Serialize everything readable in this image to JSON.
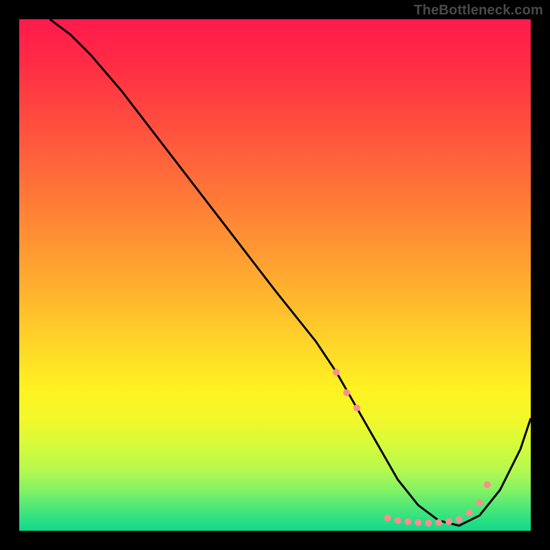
{
  "watermark": "TheBottleneck.com",
  "chart_data": {
    "type": "line",
    "title": "",
    "xlabel": "",
    "ylabel": "",
    "xlim": [
      0,
      100
    ],
    "ylim": [
      0,
      100
    ],
    "background_gradient": {
      "stops": [
        {
          "pos": 0,
          "color": "#ff1a4d"
        },
        {
          "pos": 50,
          "color": "#ffb52e"
        },
        {
          "pos": 75,
          "color": "#fff122"
        },
        {
          "pos": 100,
          "color": "#0fd98c"
        }
      ],
      "direction": "top-to-bottom"
    },
    "series": [
      {
        "name": "bottleneck-curve",
        "color": "#000000",
        "x": [
          6,
          10,
          14,
          20,
          30,
          40,
          50,
          58,
          62,
          66,
          70,
          74,
          78,
          82,
          86,
          90,
          94,
          98,
          100
        ],
        "y": [
          100,
          97,
          93,
          86,
          73,
          60,
          47,
          37,
          31,
          24,
          17,
          10,
          5,
          2,
          1,
          3,
          8,
          16,
          22
        ]
      }
    ],
    "markers": {
      "name": "highlight-points",
      "color": "#ff8d8d",
      "shape": "circle",
      "radius_px": 5,
      "points": [
        {
          "x": 62,
          "y": 31
        },
        {
          "x": 64,
          "y": 27
        },
        {
          "x": 66,
          "y": 24
        },
        {
          "x": 72,
          "y": 2.5
        },
        {
          "x": 74,
          "y": 2
        },
        {
          "x": 76,
          "y": 1.8
        },
        {
          "x": 78,
          "y": 1.6
        },
        {
          "x": 80,
          "y": 1.5
        },
        {
          "x": 82,
          "y": 1.6
        },
        {
          "x": 84,
          "y": 1.8
        },
        {
          "x": 86,
          "y": 2.2
        },
        {
          "x": 88,
          "y": 3.5
        },
        {
          "x": 90,
          "y": 5.5
        },
        {
          "x": 91.5,
          "y": 9
        }
      ]
    }
  }
}
